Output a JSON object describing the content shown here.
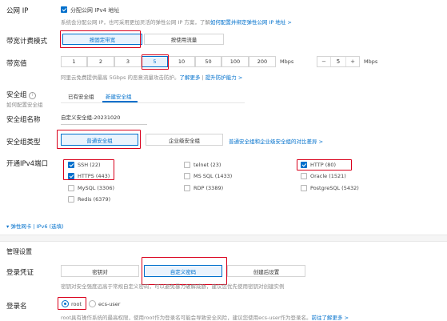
{
  "public_ip": {
    "label": "公网 IP",
    "checkbox_label": "分配公网 IPv4 地址",
    "desc": "系统会分配公网 IP，也可采用更加灵活的弹性公网 IP 方案，了解",
    "link": "如何配置并绑定弹性公网 IP 地址 >"
  },
  "billing": {
    "label": "带宽计费模式",
    "options": [
      "按固定带宽",
      "按使用流量"
    ],
    "selected": 0
  },
  "bandwidth": {
    "label": "带宽值",
    "values": [
      "1",
      "2",
      "3",
      "5",
      "10",
      "50",
      "100",
      "200"
    ],
    "selected": "5",
    "unit": "Mbps",
    "stepper_minus": "−",
    "stepper_value": "5",
    "stepper_plus": "+",
    "stepper_unit": "Mbps",
    "desc": "阿里云免费提供最高 5Gbps 的恶意流量攻击防护。",
    "link1": "了解更多",
    "sep": " | ",
    "link2": "提升防护能力 >"
  },
  "security_group": {
    "label": "安全组",
    "sublabel": "如何配置安全组",
    "tabs": [
      "已有安全组",
      "新建安全组"
    ],
    "active_tab": 1
  },
  "sg_name": {
    "label": "安全组名称",
    "value": "自定义安全组-20231020"
  },
  "sg_type": {
    "label": "安全组类型",
    "options": [
      "普通安全组",
      "企业级安全组"
    ],
    "selected": 0,
    "link": "普通安全组和企业级安全组的对比差异 >"
  },
  "ports": {
    "label": "开通IPv4端口",
    "items": [
      {
        "label": "SSH (22)",
        "checked": true
      },
      {
        "label": "telnet (23)",
        "checked": false
      },
      {
        "label": "HTTP (80)",
        "checked": true
      },
      {
        "label": "HTTPS (443)",
        "checked": true
      },
      {
        "label": "MS SQL (1433)",
        "checked": false
      },
      {
        "label": "Oracle (1521)",
        "checked": false
      },
      {
        "label": "MySQL (3306)",
        "checked": false
      },
      {
        "label": "RDP (3389)",
        "checked": false
      },
      {
        "label": "PostgreSQL (5432)",
        "checked": false
      },
      {
        "label": "Redis (6379)",
        "checked": false
      }
    ]
  },
  "elastic_nic": {
    "arrow": "▾",
    "text": "弹性网卡 | IPv6 (选填)"
  },
  "management": {
    "title": "管理设置"
  },
  "login": {
    "label": "登录凭证",
    "options": [
      "密钥对",
      "自定义密码",
      "创建后设置"
    ],
    "selected": 1,
    "desc": "密钥对安全强度远高于常规自定义密码，可以避免暴力破解威胁，建议您优先使用密钥对创建实例"
  },
  "login_name": {
    "label": "登录名",
    "options": [
      "root",
      "ecs-user"
    ],
    "selected": 0,
    "desc": "root具有操作系统的最高权限，使用root作为登录名可能会导致安全风险，建议您使用ecs-user作为登录名。",
    "link": "前往了解更多 >"
  },
  "colors": {
    "accent": "#0070cc",
    "highlight": "#d9001b"
  }
}
